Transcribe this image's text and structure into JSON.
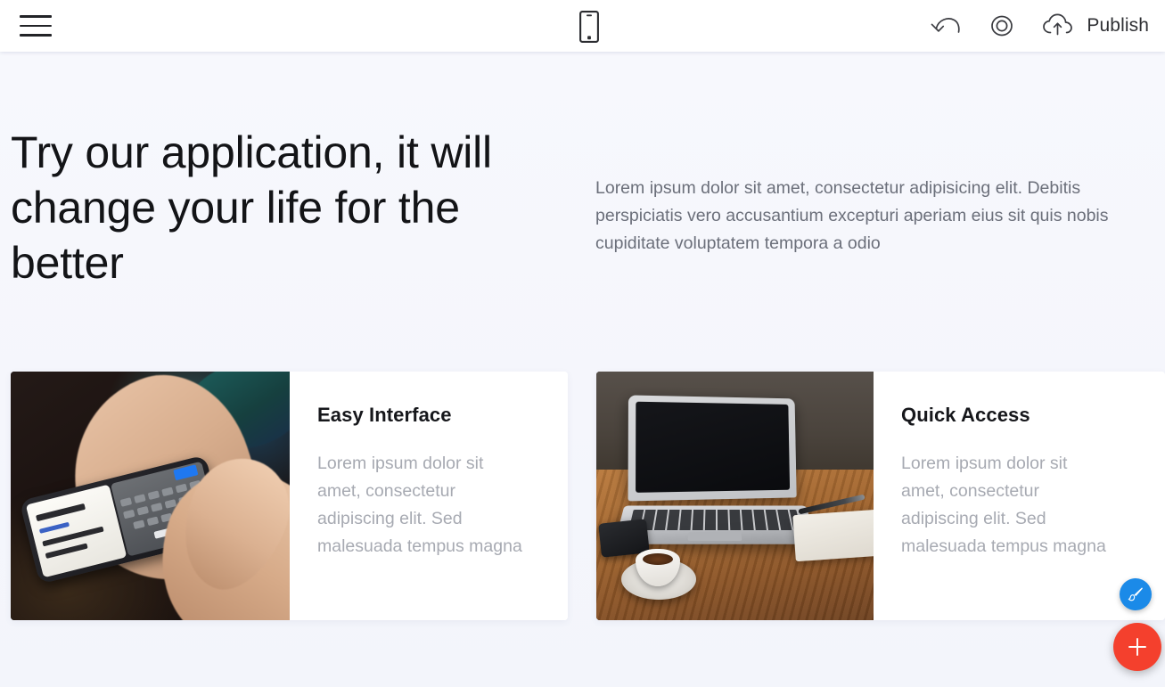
{
  "toolbar": {
    "menu_icon": "hamburger-menu-icon",
    "device_toggle_icon": "mobile-device-icon",
    "undo_icon": "undo-arrow-icon",
    "preview_icon": "eye-preview-icon",
    "publish_icon": "cloud-upload-icon",
    "publish_label": "Publish"
  },
  "hero": {
    "title": "Try our application, it will change your life for the better",
    "text": "Lorem ipsum dolor sit amet, consectetur adipisicing elit. Debitis perspiciatis vero accusantium excepturi aperiam eius sit quis nobis cupiditate voluptatem tempora a odio"
  },
  "cards": [
    {
      "title": "Easy Interface",
      "text": "Lorem ipsum dolor sit amet, consectetur adipiscing elit. Sed malesuada tempus magna",
      "image_name": "hands-holding-smartphone-photo"
    },
    {
      "title": "Quick Access",
      "text": "Lorem ipsum dolor sit amet, consectetur adipiscing elit. Sed malesuada tempus magna",
      "image_name": "laptop-on-wooden-desk-photo"
    }
  ],
  "fabs": {
    "style_icon": "paintbrush-icon",
    "add_icon": "plus-icon"
  },
  "colors": {
    "page_background": "#f6f7fc",
    "toolbar_background": "#ffffff",
    "heading": "#131417",
    "muted_text": "#6b6f7a",
    "card_text": "#a7aab2",
    "fab_style": "#1b8ae8",
    "fab_add": "#f4402d"
  }
}
